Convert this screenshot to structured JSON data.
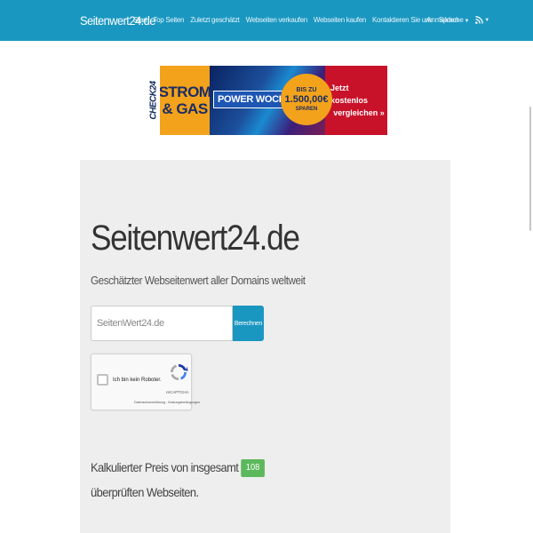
{
  "nav": {
    "brand": "Seitenwert24.de",
    "items": [
      {
        "label": "Start"
      },
      {
        "label": "Top Seiten"
      },
      {
        "label": "Zuletzt geschätzt"
      },
      {
        "label": "Webseiten verkaufen"
      },
      {
        "label": "Webseiten kaufen"
      },
      {
        "label": "Kontaktieren Sie uns"
      },
      {
        "label": "Sprache"
      }
    ],
    "login": "Anmelden",
    "accent": "#1a97c1"
  },
  "banner": {
    "logo": "CHECK24",
    "line1": "STROM",
    "line2": "& GAS",
    "title": "POWER WOCHEN",
    "badge_top": "BIS ZU",
    "badge_amount": "1.500,00€",
    "badge_bottom": "SPAREN",
    "cta_line1": "Jetzt kostenlos",
    "cta_line2": "vergleichen »"
  },
  "hero": {
    "title": "Seitenwert24.de",
    "subtitle": "Geschätzter Webseitenwert aller Domains weltweit"
  },
  "search": {
    "value": "",
    "placeholder": "SeitenWert24.de",
    "button": "Berechnen"
  },
  "captcha": {
    "label": "Ich bin kein Roboter.",
    "brand": "reCAPTCHA",
    "terms": "Datenschutzerklärung - Nutzungsbedingungen"
  },
  "stats": {
    "prefix": "Kalkulierter Preis von insgesamt",
    "count": "108",
    "suffix": "überprüften Webseiten.",
    "badge_color": "#5cb85c"
  }
}
